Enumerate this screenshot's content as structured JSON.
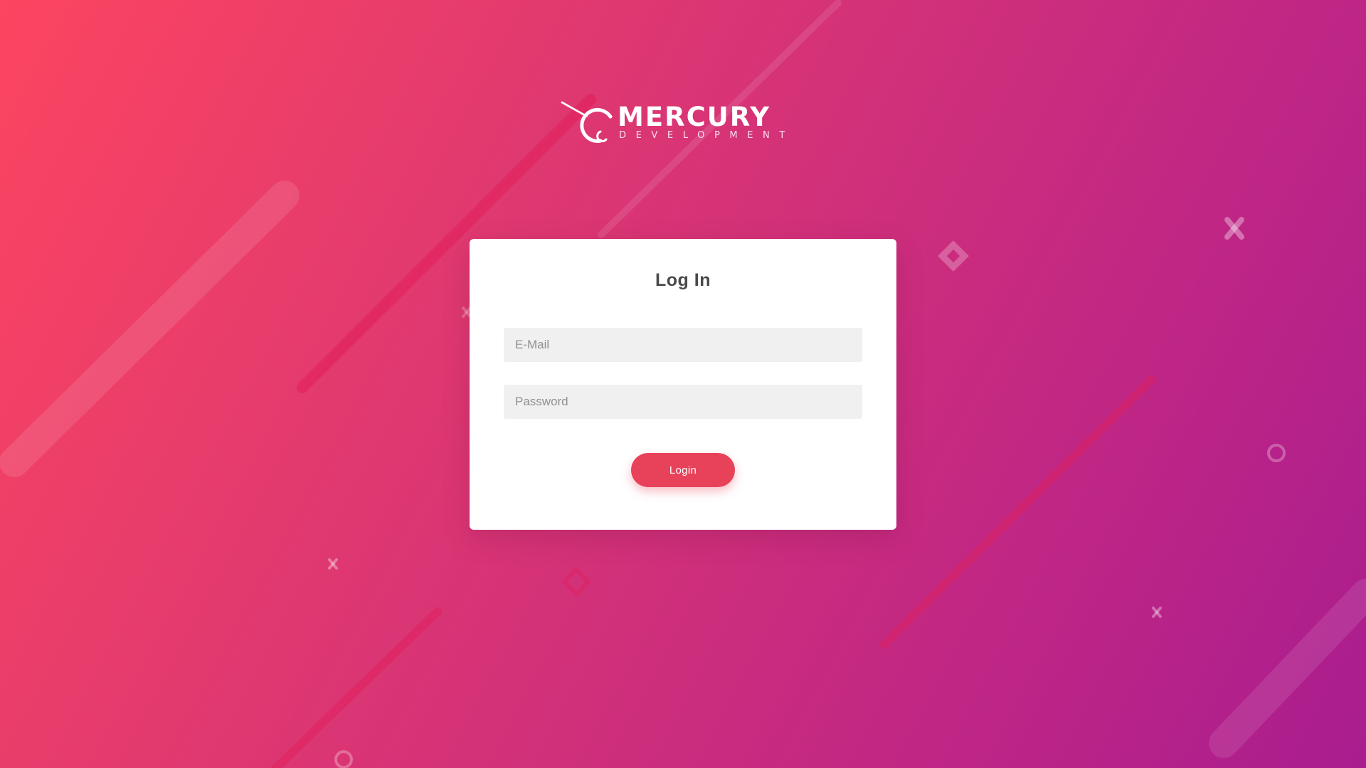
{
  "brand": {
    "name": "MERCURY",
    "tagline": "DEVELOPMENT",
    "logo_icon": "planet-ring-logo-icon"
  },
  "login_card": {
    "title": "Log In",
    "email_placeholder": "E-Mail",
    "email_value": "",
    "password_placeholder": "Password",
    "password_value": "",
    "submit_label": "Login"
  },
  "colors": {
    "gradient_start": "#fc4560",
    "gradient_end": "#a91d8f",
    "button": "#e8425a",
    "input_background": "#f0f0f0",
    "title_text": "#4a4a4a"
  },
  "decorations": [
    "diagonal-stripe",
    "x-mark-icon",
    "diamond-icon",
    "ring-icon"
  ]
}
